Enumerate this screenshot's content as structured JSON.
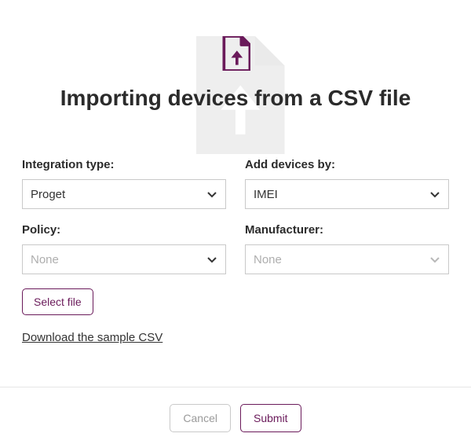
{
  "header": {
    "title": "Importing devices from a CSV file",
    "icon": "file-upload-icon"
  },
  "fields": {
    "integration_type": {
      "label": "Integration type:",
      "value": "Proget",
      "placeholder": false,
      "disabled": false
    },
    "add_devices_by": {
      "label": "Add devices by:",
      "value": "IMEI",
      "placeholder": false,
      "disabled": false
    },
    "policy": {
      "label": "Policy:",
      "value": "None",
      "placeholder": true,
      "disabled": false
    },
    "manufacturer": {
      "label": "Manufacturer:",
      "value": "None",
      "placeholder": true,
      "disabled": true
    }
  },
  "actions": {
    "select_file": "Select file",
    "download_sample": "Download the sample CSV",
    "cancel": "Cancel",
    "submit": "Submit"
  },
  "colors": {
    "accent": "#6a1a5a",
    "border": "#c9c9c9",
    "text": "#2b2b2b",
    "muted": "#aeaeae"
  }
}
